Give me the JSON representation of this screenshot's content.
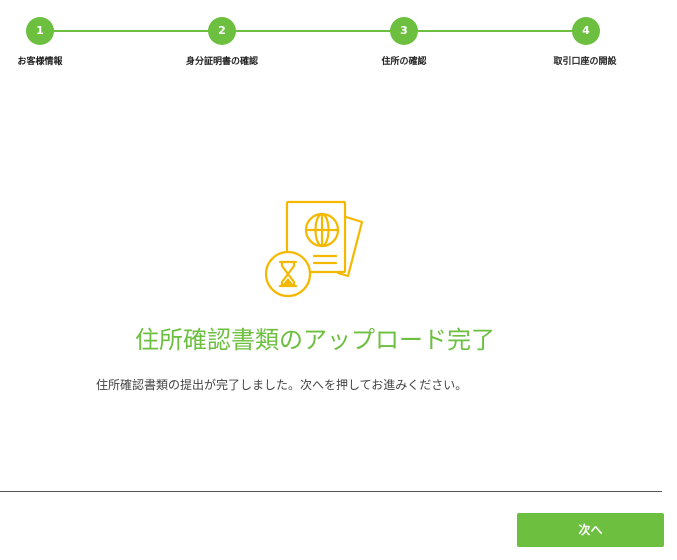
{
  "colors": {
    "accent": "#6cbf3f",
    "illustration": "#f5b800"
  },
  "stepper": {
    "steps": [
      {
        "number": "1",
        "label": "お客様情報"
      },
      {
        "number": "2",
        "label": "身分証明書の確認"
      },
      {
        "number": "3",
        "label": "住所の確認"
      },
      {
        "number": "4",
        "label": "取引口座の開設"
      }
    ]
  },
  "main": {
    "illustration_icon": "passport-hourglass-icon",
    "title": "住所確認書類のアップロード完了",
    "message": "住所確認書類の提出が完了しました。次へを押してお進みください。"
  },
  "footer": {
    "next_label": "次へ"
  }
}
